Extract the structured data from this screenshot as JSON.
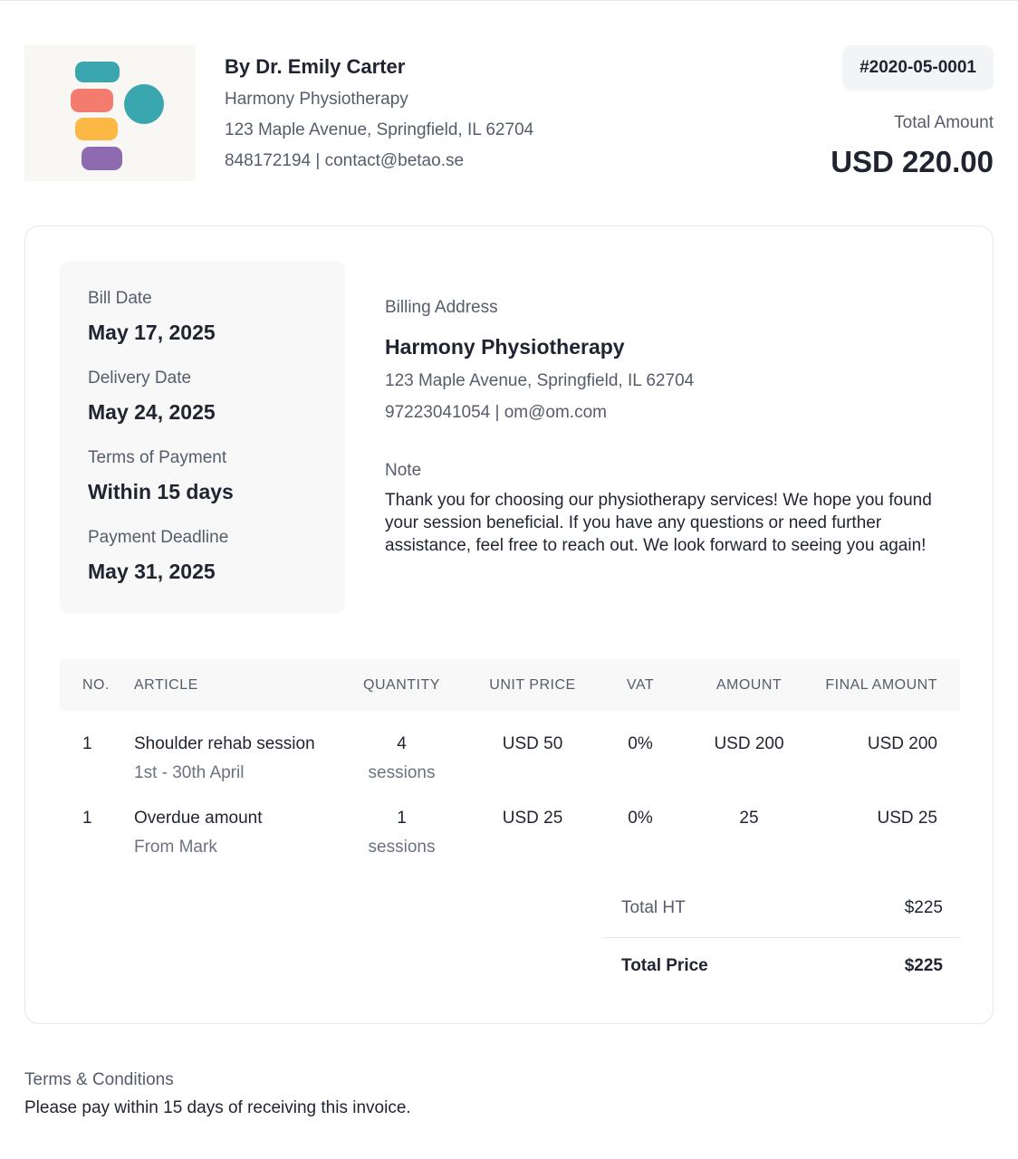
{
  "header": {
    "issuer_name": "By Dr. Emily Carter",
    "company": "Harmony Physiotherapy",
    "address": "123 Maple Avenue, Springfield, IL 62704",
    "contact": "848172194 | contact@betao.se",
    "invoice_number": "#2020-05-0001",
    "total_label": "Total Amount",
    "total_value": "USD 220.00"
  },
  "logo": {
    "colors": {
      "teal": "#3aa6ad",
      "salmon": "#f47c6e",
      "yellow": "#fbb844",
      "purple": "#8e6bb0"
    },
    "background": "#f8f7f4"
  },
  "dates": [
    {
      "label": "Bill Date",
      "value": "May 17, 2025"
    },
    {
      "label": "Delivery Date",
      "value": "May 24, 2025"
    },
    {
      "label": "Terms of Payment",
      "value": "Within 15 days"
    },
    {
      "label": "Payment Deadline",
      "value": "May 31, 2025"
    }
  ],
  "billing": {
    "label": "Billing Address",
    "name": "Harmony Physiotherapy",
    "address": "123 Maple Avenue, Springfield, IL 62704",
    "contact": "97223041054 | om@om.com",
    "note_label": "Note",
    "note_text": "Thank you for choosing our physiotherapy services! We hope you found your session beneficial. If you have any questions or need further assistance, feel free to reach out. We look forward to seeing you again!"
  },
  "table": {
    "headers": {
      "no": "NO.",
      "article": "ARTICLE",
      "quantity": "QUANTITY",
      "unit_price": "UNIT PRICE",
      "vat": "VAT",
      "amount": "AMOUNT",
      "final_amount": "FINAL AMOUNT"
    },
    "rows": [
      {
        "no": "1",
        "article": "Shoulder rehab session",
        "article_sub": "1st - 30th April",
        "quantity": "4",
        "quantity_unit": "sessions",
        "unit_price": "USD 50",
        "vat": "0%",
        "amount": "USD 200",
        "final_amount": "USD 200"
      },
      {
        "no": "1",
        "article": "Overdue amount",
        "article_sub": "From Mark",
        "quantity": "1",
        "quantity_unit": "sessions",
        "unit_price": "USD 25",
        "vat": "0%",
        "amount": "25",
        "final_amount": "USD 25"
      }
    ]
  },
  "totals": {
    "subtotal_label": "Total HT",
    "subtotal_value": "$225",
    "total_label": "Total Price",
    "total_value": "$225"
  },
  "terms": {
    "label": "Terms & Conditions",
    "text": "Please pay within 15 days of receiving this invoice."
  }
}
